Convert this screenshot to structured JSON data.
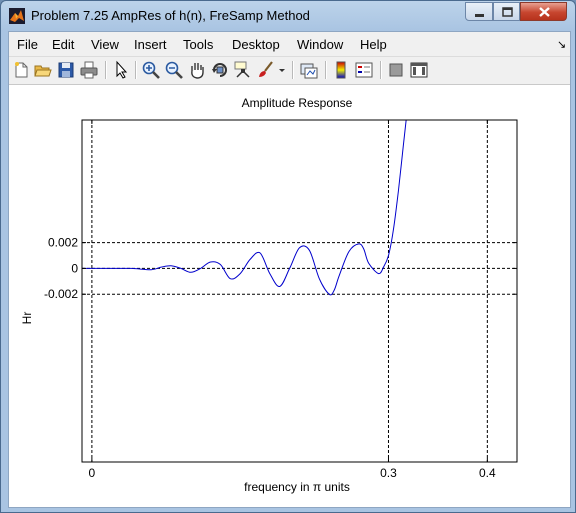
{
  "window": {
    "title": "Problem 7.25 AmpRes of h(n), FreSamp Method",
    "controls": [
      "minimize-icon",
      "maximize-icon",
      "close-icon"
    ]
  },
  "menubar": {
    "items": [
      "File",
      "Edit",
      "View",
      "Insert",
      "Tools",
      "Desktop",
      "Window",
      "Help"
    ],
    "dock_arrow": "↘"
  },
  "toolbar": {
    "buttons": [
      "new-figure-icon",
      "open-file-icon",
      "save-figure-icon",
      "print-figure-icon",
      "edit-plot-arrow-icon",
      "zoom-in-icon",
      "zoom-out-icon",
      "pan-hand-icon",
      "rotate-3d-icon",
      "data-cursor-icon",
      "brush-icon",
      "brush-dropdown-icon",
      "link-plot-icon",
      "insert-colorbar-icon",
      "insert-legend-icon",
      "hide-plot-tools-icon",
      "show-plot-tools-icon"
    ]
  },
  "chart_data": {
    "type": "line",
    "title": "Amplitude Response",
    "xlabel": "frequency in π units",
    "ylabel": "Hr",
    "xlim": [
      -0.01,
      0.43
    ],
    "ylim": [
      -0.015,
      0.0115
    ],
    "xticks": [
      "0",
      "0.3",
      "0.4"
    ],
    "xtick_values": [
      0,
      0.3,
      0.4
    ],
    "yticks": [
      "0.002",
      "0",
      "-0.002"
    ],
    "ytick_values": [
      0.002,
      0,
      -0.002
    ],
    "reference_lines": {
      "x": [
        0,
        0.3,
        0.4
      ],
      "y": [
        0.002,
        0,
        -0.002
      ],
      "style": "dashed"
    },
    "grid": false,
    "legend": "none",
    "line_color": "#0000cc",
    "series": [
      {
        "x": [
          -0.01,
          0.0,
          0.02,
          0.04,
          0.06,
          0.07,
          0.08,
          0.09,
          0.1,
          0.11,
          0.12,
          0.13,
          0.14,
          0.15,
          0.16,
          0.17,
          0.18,
          0.19,
          0.2,
          0.21,
          0.22,
          0.23,
          0.24,
          0.245,
          0.25,
          0.26,
          0.27,
          0.275,
          0.28,
          0.29,
          0.295,
          0.3,
          0.305,
          0.31,
          0.315,
          0.32
        ],
        "y": [
          0.0,
          0.0,
          0.0,
          0.0,
          -0.0001,
          0.0001,
          0.0002,
          0.0,
          -0.0003,
          0.0,
          0.0005,
          0.0003,
          -0.0008,
          -0.0004,
          0.0007,
          0.0012,
          -0.0004,
          -0.0014,
          0.0,
          0.0016,
          0.0014,
          -0.0008,
          -0.002,
          -0.0017,
          -0.0006,
          0.0013,
          0.0019,
          0.0015,
          0.0004,
          -0.0004,
          0.0001,
          0.001,
          0.003,
          0.006,
          0.0095,
          0.013
        ]
      }
    ]
  }
}
